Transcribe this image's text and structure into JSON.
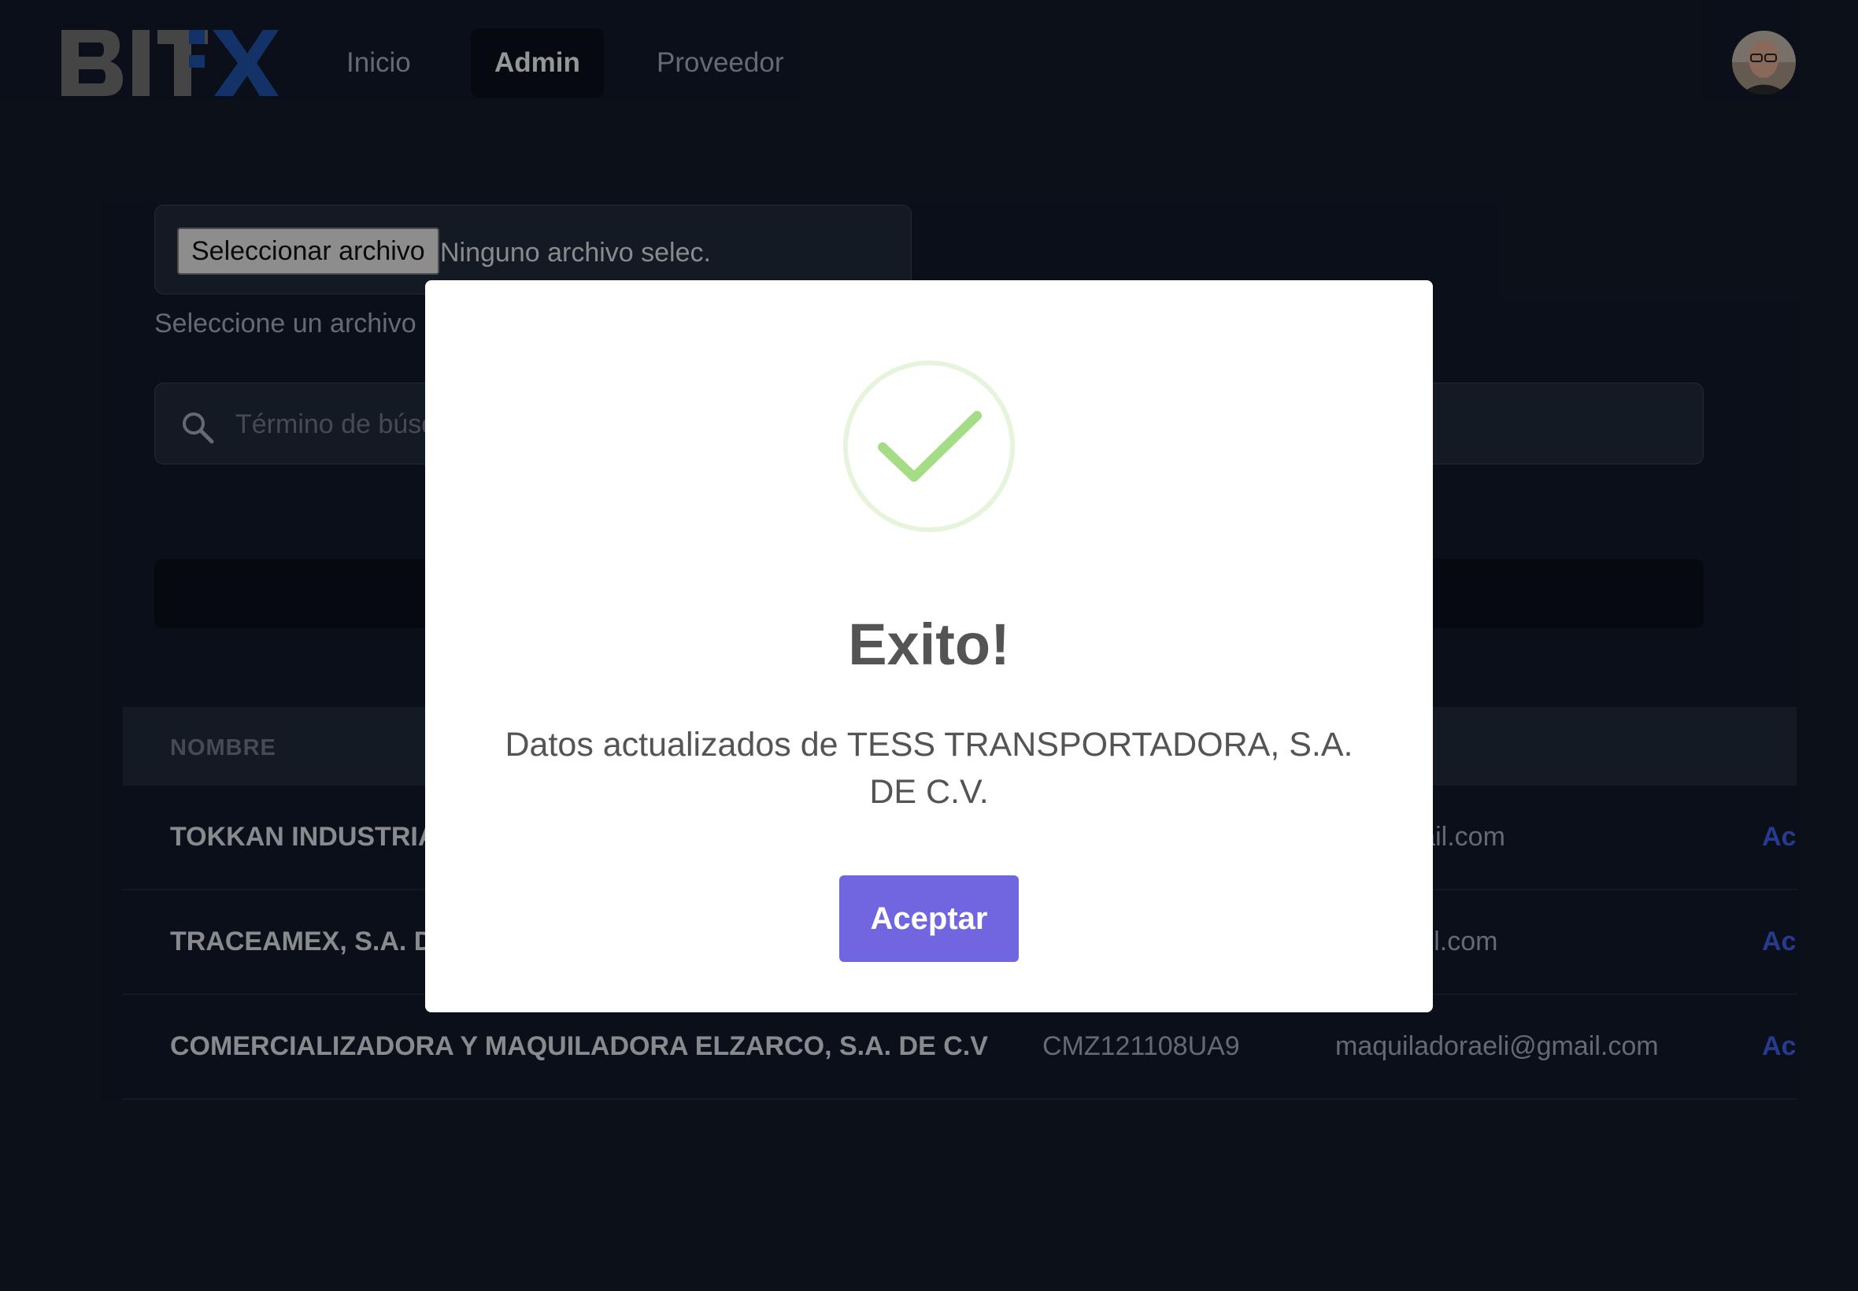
{
  "nav": {
    "logo_text": "BITFX",
    "links": [
      {
        "label": "Inicio"
      },
      {
        "label": "Admin"
      },
      {
        "label": "Proveedor"
      }
    ]
  },
  "upload": {
    "button_label": "Seleccionar archivo",
    "status": "Ninguno archivo selec.",
    "help": "Seleccione un archivo"
  },
  "search": {
    "placeholder": "Término de búsqueda"
  },
  "table": {
    "headers": [
      "NOMBRE"
    ],
    "rows": [
      {
        "name": "TOKKAN INDUSTRIA",
        "rfc": "",
        "email": "al@gmail.com",
        "action": "Acc"
      },
      {
        "name": "TRACEAMEX, S.A. DE",
        "rfc": "",
        "email": "x@gmail.com",
        "action": "Acc"
      },
      {
        "name": "COMERCIALIZADORA Y MAQUILADORA ELZARCO, S.A. DE C.V",
        "rfc": "CMZ121108UA9",
        "email": "maquiladoraeli@gmail.com",
        "action": "Acc"
      }
    ]
  },
  "modal": {
    "title": "Exito!",
    "message": "Datos actualizados de TESS TRANSPORTADORA, S.A. DE C.V.",
    "confirm_label": "Aceptar",
    "icon": "success-check-icon",
    "confirm_color": "#7066e0",
    "check_color": "#a5dc86"
  }
}
